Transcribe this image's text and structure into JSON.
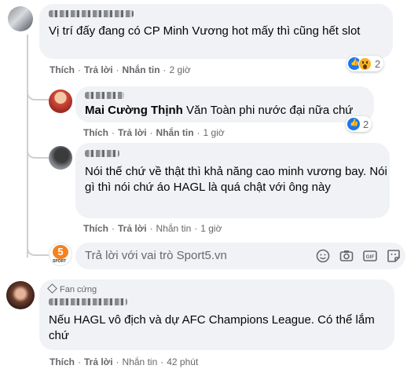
{
  "comments": [
    {
      "text": "Vị trí đấy đang có CP Minh Vương hot mấy thì cũng hết slot",
      "like_label": "Thích",
      "reply_label": "Trả lời",
      "message_label": "Nhắn tin",
      "time": "2 giờ",
      "reaction_count": "2"
    },
    {
      "tagged_name": "Mai Cường Thịnh",
      "text": " Văn Toàn phi nước đại nữa chứ",
      "like_label": "Thích",
      "reply_label": "Trả lời",
      "message_label": "Nhắn tin",
      "time": "1 giờ",
      "reaction_count": "2"
    },
    {
      "text": "Nói thế chứ về thật thì khả năng cao minh vương bay. Nói gì thì nói chứ áo HAGL là quá chật với ông này",
      "like_label": "Thích",
      "reply_label": "Trả lời",
      "message_label": "Nhắn tin",
      "time": "1 giờ"
    },
    {
      "badge": "Fan cứng",
      "text": "Nếu HAGL vô địch và dự AFC Champions League. Có thể lắm chứ",
      "like_label": "Thích",
      "reply_label": "Trả lời",
      "message_label": "Nhắn tin",
      "time": "42 phút"
    }
  ],
  "reply_box": {
    "placeholder": "Trả lời với vai trò Sport5.vn",
    "avatar_text": "5",
    "avatar_sub": "SPORT",
    "tools": [
      "emoji-icon",
      "camera-icon",
      "gif-icon",
      "sticker-icon"
    ]
  },
  "colors": {
    "bubble": "#f0f2f5",
    "meta": "#65676b",
    "like": "#1877f2",
    "brand": "#f58220"
  }
}
